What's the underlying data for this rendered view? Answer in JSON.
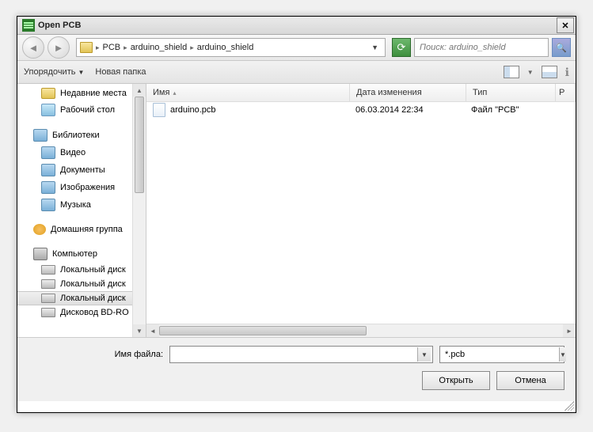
{
  "window": {
    "title": "Open PCB"
  },
  "breadcrumb": {
    "parts": [
      "PCB",
      "arduino_shield",
      "arduino_shield"
    ]
  },
  "search": {
    "placeholder": "Поиск: arduino_shield"
  },
  "toolbar": {
    "organize": "Упорядочить",
    "newfolder": "Новая папка"
  },
  "sidebar": {
    "items": [
      {
        "label": "Недавние места",
        "icon": "folder",
        "level": 1
      },
      {
        "label": "Рабочий стол",
        "icon": "desktop",
        "level": 1
      },
      {
        "sep": true
      },
      {
        "label": "Библиотеки",
        "icon": "lib",
        "level": 0
      },
      {
        "label": "Видео",
        "icon": "lib",
        "level": 1
      },
      {
        "label": "Документы",
        "icon": "lib",
        "level": 1
      },
      {
        "label": "Изображения",
        "icon": "lib",
        "level": 1
      },
      {
        "label": "Музыка",
        "icon": "lib",
        "level": 1
      },
      {
        "sep": true
      },
      {
        "label": "Домашняя группа",
        "icon": "group",
        "level": 0
      },
      {
        "sep": true
      },
      {
        "label": "Компьютер",
        "icon": "comp",
        "level": 0
      },
      {
        "label": "Локальный диск",
        "icon": "disk",
        "level": 1
      },
      {
        "label": "Локальный диск",
        "icon": "disk",
        "level": 1
      },
      {
        "label": "Локальный диск",
        "icon": "disk",
        "level": 1,
        "selected": true
      },
      {
        "label": "Дисковод BD-RO",
        "icon": "disk",
        "level": 1
      }
    ]
  },
  "columns": {
    "name": "Имя",
    "date": "Дата изменения",
    "type": "Тип",
    "extra": "Р"
  },
  "files": [
    {
      "name": "arduino.pcb",
      "date": "06.03.2014 22:34",
      "type": "Файл \"PCB\""
    }
  ],
  "bottom": {
    "filename_label": "Имя файла:",
    "filename_value": "",
    "filter": "*.pcb",
    "open": "Открыть",
    "cancel": "Отмена"
  }
}
